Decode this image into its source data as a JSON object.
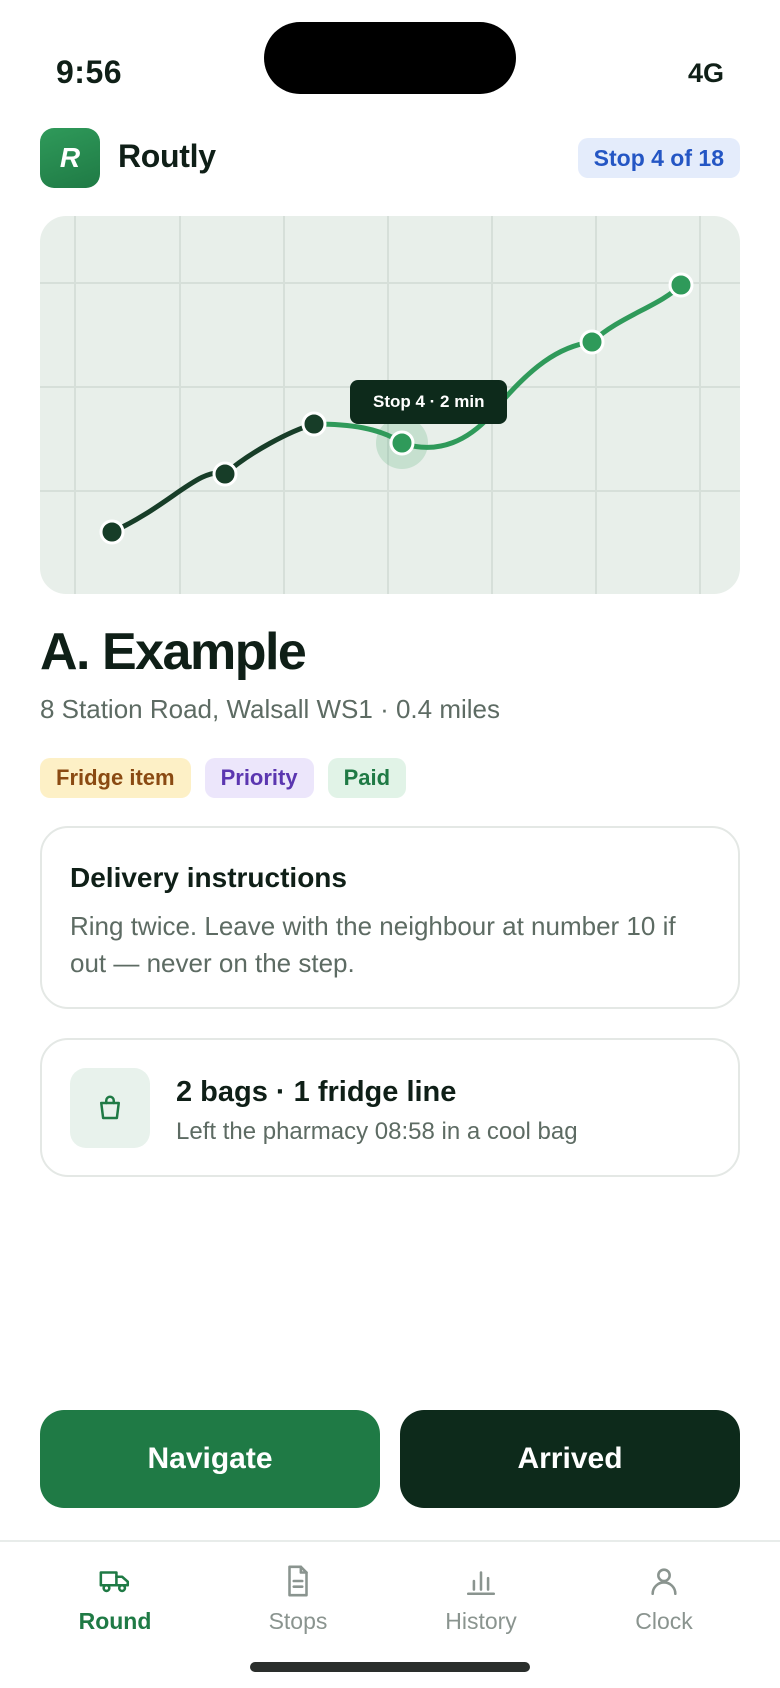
{
  "status": {
    "time": "9:56",
    "network": "4G"
  },
  "app": {
    "logo_letter": "R",
    "name": "Routly",
    "stop_counter": "Stop 4 of 18"
  },
  "map": {
    "tooltip": "Stop 4 · 2 min"
  },
  "recipient": {
    "name": "A. Example",
    "address": "8 Station Road, Walsall WS1 · 0.4 miles"
  },
  "tags": [
    {
      "label": "Fridge item"
    },
    {
      "label": "Priority"
    },
    {
      "label": "Paid"
    }
  ],
  "instructions": {
    "title": "Delivery instructions",
    "body": "Ring twice. Leave with the neighbour at number 10 if out — never on the step."
  },
  "package": {
    "icon": "bag-icon",
    "title": "2 bags · 1 fridge line",
    "subtitle": "Left the pharmacy 08:58 in a cool bag"
  },
  "actions": {
    "navigate": "Navigate",
    "arrived": "Arrived"
  },
  "tabs": [
    {
      "label": "Round",
      "icon": "van-icon",
      "active": true
    },
    {
      "label": "Stops",
      "icon": "document-icon",
      "active": false
    },
    {
      "label": "History",
      "icon": "bar-chart-icon",
      "active": false
    },
    {
      "label": "Clock",
      "icon": "person-icon",
      "active": false
    }
  ],
  "colors": {
    "brand": "#1f7a45",
    "dark": "#0d2a1b",
    "route_done": "#173d28",
    "route_next": "#2f9a5a"
  }
}
